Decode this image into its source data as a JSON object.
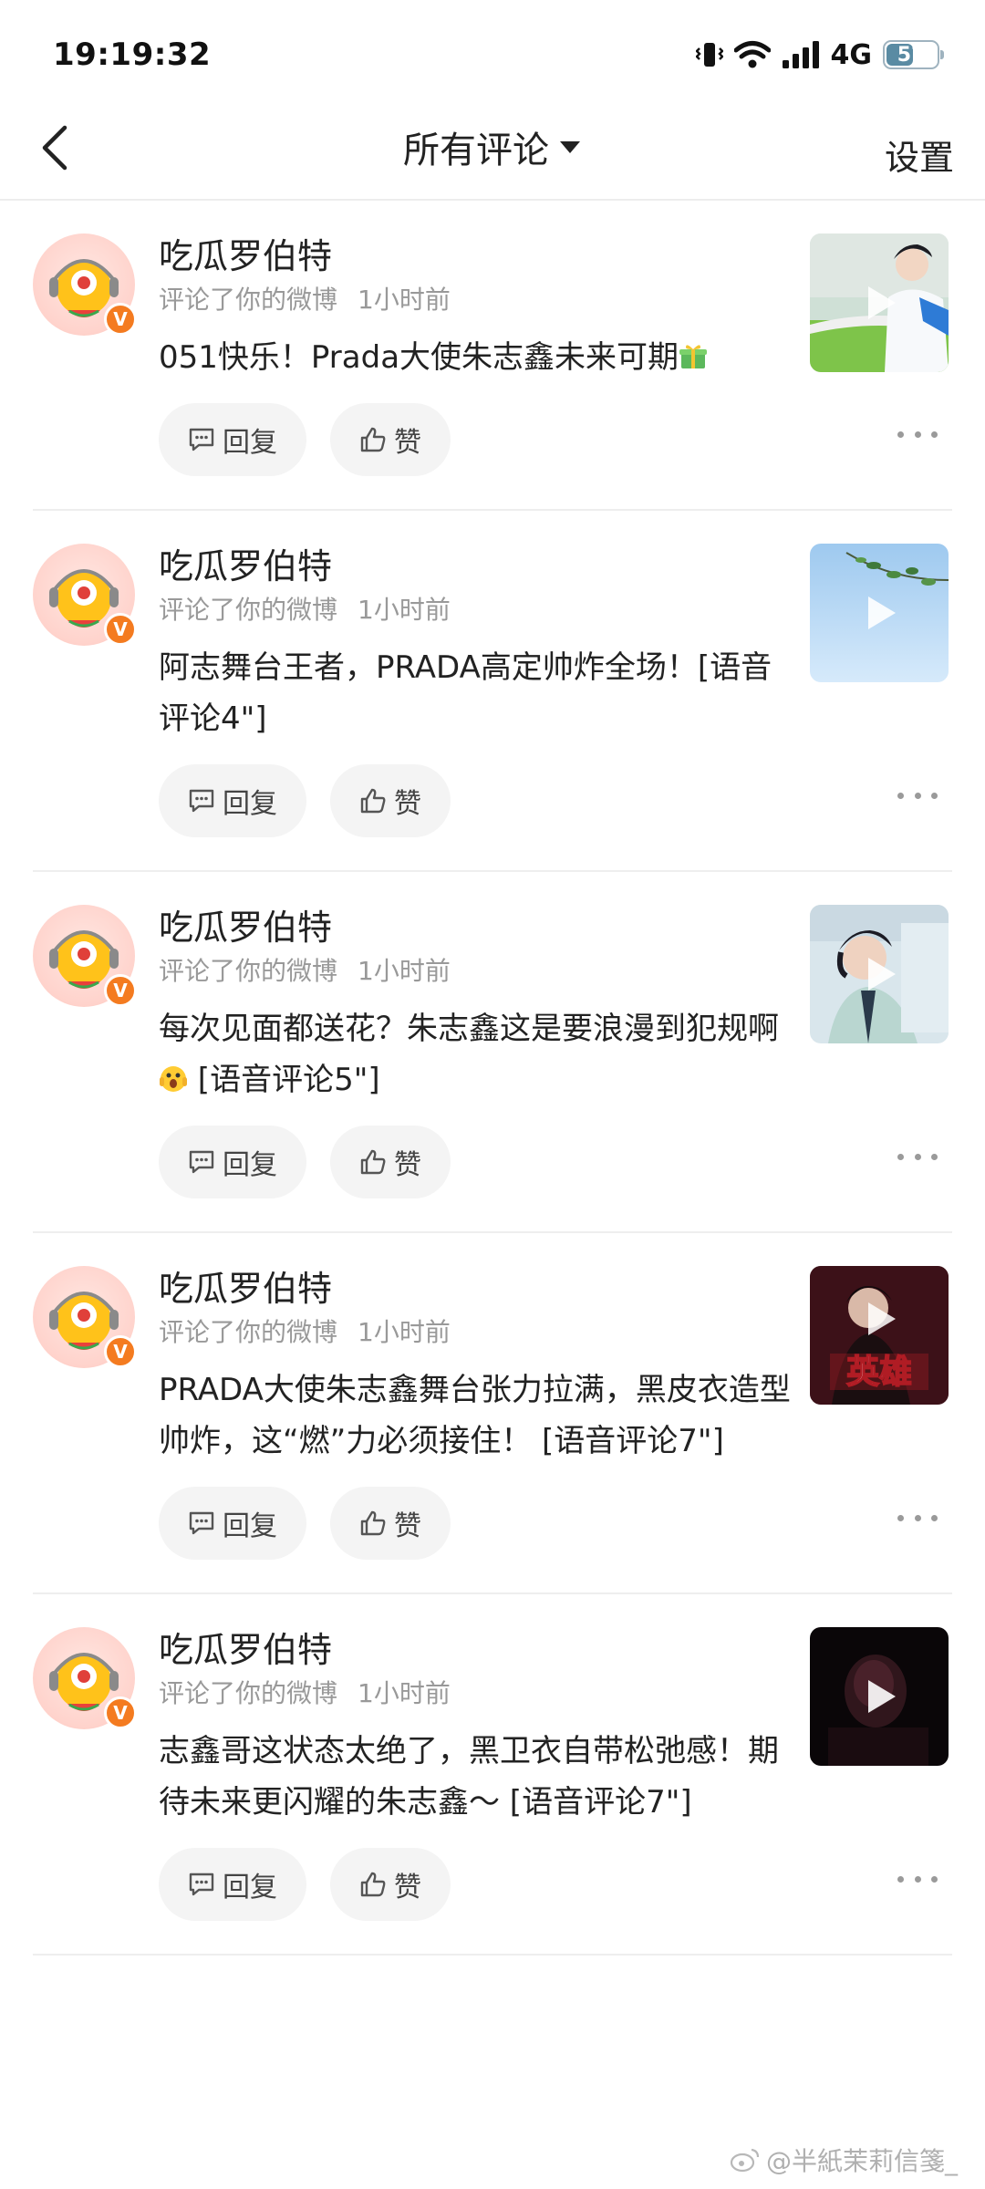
{
  "status_bar": {
    "time": "19:19:32",
    "network": "4G",
    "battery": "57",
    "battery_level_percent": 57
  },
  "header": {
    "title": "所有评论",
    "settings_label": "设置"
  },
  "comments": [
    {
      "username": "吃瓜罗伯特",
      "action": "评论了你的微博",
      "time": "1小时前",
      "text": "051快乐！Prada大使朱志鑫未来可期",
      "trailing_emoji": "gift",
      "reply_label": "回复",
      "like_label": "赞"
    },
    {
      "username": "吃瓜罗伯特",
      "action": "评论了你的微博",
      "time": "1小时前",
      "text": "阿志舞台王者，PRADA高定帅炸全场！[语音评论4\"]",
      "reply_label": "回复",
      "like_label": "赞"
    },
    {
      "username": "吃瓜罗伯特",
      "action": "评论了你的微博",
      "time": "1小时前",
      "text_before_emoji": "每次见面都送花？朱志鑫这是要浪漫到犯规啊",
      "text_after_emoji": " [语音评论5\"]",
      "inline_emoji": "shocked",
      "reply_label": "回复",
      "like_label": "赞"
    },
    {
      "username": "吃瓜罗伯特",
      "action": "评论了你的微博",
      "time": "1小时前",
      "text": "PRADA大使朱志鑫舞台张力拉满，黑皮衣造型帅炸，这“燃”力必须接住！ [语音评论7\"]",
      "thumb_caption": "英雄",
      "reply_label": "回复",
      "like_label": "赞"
    },
    {
      "username": "吃瓜罗伯特",
      "action": "评论了你的微博",
      "time": "1小时前",
      "text": "志鑫哥这状态太绝了，黑卫衣自带松弛感！期待未来更闪耀的朱志鑫～ [语音评论7\"]",
      "reply_label": "回复",
      "like_label": "赞"
    }
  ],
  "watermark": "@半紙茉莉信箋_",
  "colors": {
    "badge_orange": "#f47b20",
    "pill_bg": "#f4f4f4",
    "meta_gray": "#999999"
  }
}
